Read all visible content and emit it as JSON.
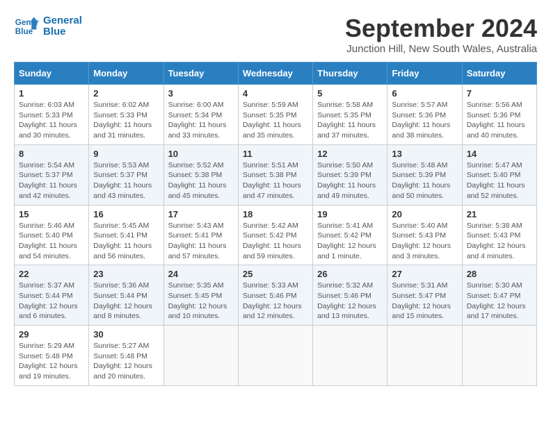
{
  "logo": {
    "line1": "General",
    "line2": "Blue"
  },
  "title": "September 2024",
  "location": "Junction Hill, New South Wales, Australia",
  "weekdays": [
    "Sunday",
    "Monday",
    "Tuesday",
    "Wednesday",
    "Thursday",
    "Friday",
    "Saturday"
  ],
  "weeks": [
    [
      {
        "day": "1",
        "sunrise": "6:03 AM",
        "sunset": "5:33 PM",
        "daylight": "11 hours and 30 minutes."
      },
      {
        "day": "2",
        "sunrise": "6:02 AM",
        "sunset": "5:33 PM",
        "daylight": "11 hours and 31 minutes."
      },
      {
        "day": "3",
        "sunrise": "6:00 AM",
        "sunset": "5:34 PM",
        "daylight": "11 hours and 33 minutes."
      },
      {
        "day": "4",
        "sunrise": "5:59 AM",
        "sunset": "5:35 PM",
        "daylight": "11 hours and 35 minutes."
      },
      {
        "day": "5",
        "sunrise": "5:58 AM",
        "sunset": "5:35 PM",
        "daylight": "11 hours and 37 minutes."
      },
      {
        "day": "6",
        "sunrise": "5:57 AM",
        "sunset": "5:36 PM",
        "daylight": "11 hours and 38 minutes."
      },
      {
        "day": "7",
        "sunrise": "5:56 AM",
        "sunset": "5:36 PM",
        "daylight": "11 hours and 40 minutes."
      }
    ],
    [
      {
        "day": "8",
        "sunrise": "5:54 AM",
        "sunset": "5:37 PM",
        "daylight": "11 hours and 42 minutes."
      },
      {
        "day": "9",
        "sunrise": "5:53 AM",
        "sunset": "5:37 PM",
        "daylight": "11 hours and 43 minutes."
      },
      {
        "day": "10",
        "sunrise": "5:52 AM",
        "sunset": "5:38 PM",
        "daylight": "11 hours and 45 minutes."
      },
      {
        "day": "11",
        "sunrise": "5:51 AM",
        "sunset": "5:38 PM",
        "daylight": "11 hours and 47 minutes."
      },
      {
        "day": "12",
        "sunrise": "5:50 AM",
        "sunset": "5:39 PM",
        "daylight": "11 hours and 49 minutes."
      },
      {
        "day": "13",
        "sunrise": "5:48 AM",
        "sunset": "5:39 PM",
        "daylight": "11 hours and 50 minutes."
      },
      {
        "day": "14",
        "sunrise": "5:47 AM",
        "sunset": "5:40 PM",
        "daylight": "11 hours and 52 minutes."
      }
    ],
    [
      {
        "day": "15",
        "sunrise": "5:46 AM",
        "sunset": "5:40 PM",
        "daylight": "11 hours and 54 minutes."
      },
      {
        "day": "16",
        "sunrise": "5:45 AM",
        "sunset": "5:41 PM",
        "daylight": "11 hours and 56 minutes."
      },
      {
        "day": "17",
        "sunrise": "5:43 AM",
        "sunset": "5:41 PM",
        "daylight": "11 hours and 57 minutes."
      },
      {
        "day": "18",
        "sunrise": "5:42 AM",
        "sunset": "5:42 PM",
        "daylight": "11 hours and 59 minutes."
      },
      {
        "day": "19",
        "sunrise": "5:41 AM",
        "sunset": "5:42 PM",
        "daylight": "12 hours and 1 minute."
      },
      {
        "day": "20",
        "sunrise": "5:40 AM",
        "sunset": "5:43 PM",
        "daylight": "12 hours and 3 minutes."
      },
      {
        "day": "21",
        "sunrise": "5:38 AM",
        "sunset": "5:43 PM",
        "daylight": "12 hours and 4 minutes."
      }
    ],
    [
      {
        "day": "22",
        "sunrise": "5:37 AM",
        "sunset": "5:44 PM",
        "daylight": "12 hours and 6 minutes."
      },
      {
        "day": "23",
        "sunrise": "5:36 AM",
        "sunset": "5:44 PM",
        "daylight": "12 hours and 8 minutes."
      },
      {
        "day": "24",
        "sunrise": "5:35 AM",
        "sunset": "5:45 PM",
        "daylight": "12 hours and 10 minutes."
      },
      {
        "day": "25",
        "sunrise": "5:33 AM",
        "sunset": "5:46 PM",
        "daylight": "12 hours and 12 minutes."
      },
      {
        "day": "26",
        "sunrise": "5:32 AM",
        "sunset": "5:46 PM",
        "daylight": "12 hours and 13 minutes."
      },
      {
        "day": "27",
        "sunrise": "5:31 AM",
        "sunset": "5:47 PM",
        "daylight": "12 hours and 15 minutes."
      },
      {
        "day": "28",
        "sunrise": "5:30 AM",
        "sunset": "5:47 PM",
        "daylight": "12 hours and 17 minutes."
      }
    ],
    [
      {
        "day": "29",
        "sunrise": "5:29 AM",
        "sunset": "5:48 PM",
        "daylight": "12 hours and 19 minutes."
      },
      {
        "day": "30",
        "sunrise": "5:27 AM",
        "sunset": "5:48 PM",
        "daylight": "12 hours and 20 minutes."
      },
      null,
      null,
      null,
      null,
      null
    ]
  ],
  "labels": {
    "sunrise_prefix": "Sunrise: ",
    "sunset_prefix": "Sunset: ",
    "daylight_prefix": "Daylight: "
  }
}
